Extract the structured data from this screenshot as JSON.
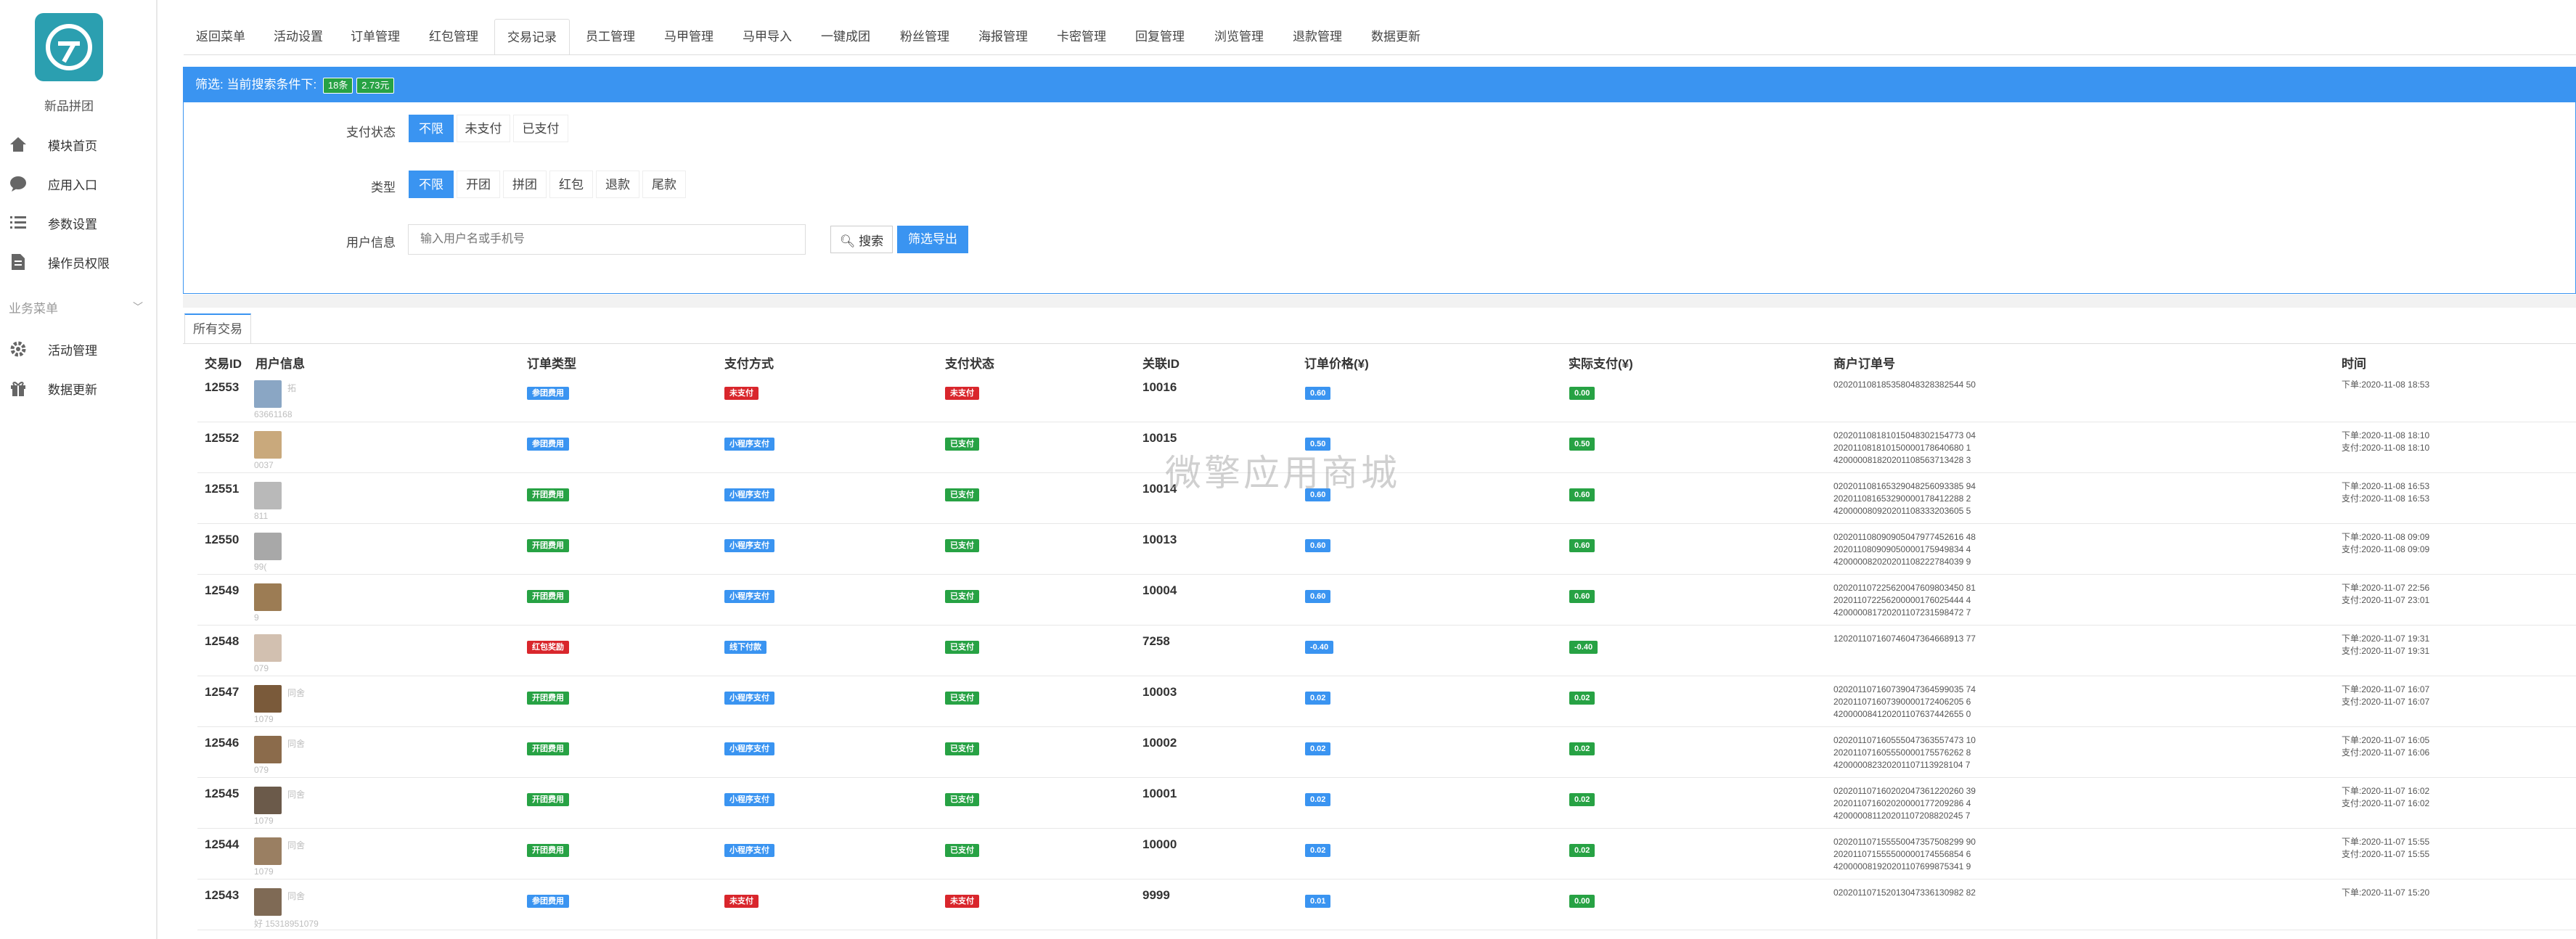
{
  "app": {
    "name": "新品拼团",
    "watermark": "微擎应用商城"
  },
  "sidebar": {
    "items": [
      {
        "label": "模块首页",
        "icon": "home-icon"
      },
      {
        "label": "应用入口",
        "icon": "chat-icon"
      },
      {
        "label": "参数设置",
        "icon": "list-icon"
      },
      {
        "label": "操作员权限",
        "icon": "document-icon"
      }
    ],
    "group": {
      "label": "业务菜单",
      "items": [
        {
          "label": "活动管理",
          "icon": "gear-icon"
        },
        {
          "label": "数据更新",
          "icon": "gift-icon"
        }
      ]
    }
  },
  "tabs": [
    {
      "label": "返回菜单"
    },
    {
      "label": "活动设置"
    },
    {
      "label": "订单管理"
    },
    {
      "label": "红包管理"
    },
    {
      "label": "交易记录",
      "active": true
    },
    {
      "label": "员工管理"
    },
    {
      "label": "马甲管理"
    },
    {
      "label": "马甲导入"
    },
    {
      "label": "一键成团"
    },
    {
      "label": "粉丝管理"
    },
    {
      "label": "海报管理"
    },
    {
      "label": "卡密管理"
    },
    {
      "label": "回复管理"
    },
    {
      "label": "浏览管理"
    },
    {
      "label": "退款管理"
    },
    {
      "label": "数据更新"
    }
  ],
  "filter": {
    "header": "筛选: 当前搜索条件下:",
    "count_badge": "18条",
    "amount_badge": "2.73元",
    "pay_status": {
      "label": "支付状态",
      "options": [
        "不限",
        "未支付",
        "已支付"
      ],
      "selected": "不限"
    },
    "type": {
      "label": "类型",
      "options": [
        "不限",
        "开团",
        "拼团",
        "红包",
        "退款",
        "尾款"
      ],
      "selected": "不限"
    },
    "user": {
      "label": "用户信息",
      "placeholder": "输入用户名或手机号"
    },
    "search_button": "搜索",
    "export_button": "筛选导出"
  },
  "table": {
    "tab_label": "所有交易",
    "headers": [
      "交易ID",
      "用户信息",
      "订单类型",
      "支付方式",
      "支付状态",
      "关联ID",
      "订单价格(¥)",
      "实际支付(¥)",
      "商户订单号",
      "时间"
    ],
    "rows": [
      {
        "id": "12553",
        "user": "拓",
        "phone": "63661168",
        "order_type": "参团费用",
        "pay_method": "未支付",
        "pay_status": "未支付",
        "ref_id": "10016",
        "price": "0.60",
        "paid": "0.00",
        "merchant": [
          "020201108185358048328382544 50"
        ],
        "time": [
          "下单:2020-11-08 18:53"
        ]
      },
      {
        "id": "12552",
        "user": "",
        "phone": "0037",
        "order_type": "参团费用",
        "pay_method": "小程序支付",
        "pay_status": "已支付",
        "ref_id": "10015",
        "price": "0.50",
        "paid": "0.50",
        "merchant": [
          "020201108181015048302154773 04",
          "202011081810150000178640680 1",
          "420000081820201108563713428 3"
        ],
        "time": [
          "下单:2020-11-08 18:10",
          "支付:2020-11-08 18:10"
        ]
      },
      {
        "id": "12551",
        "user": "",
        "phone": "811",
        "order_type": "开团费用",
        "pay_method": "小程序支付",
        "pay_status": "已支付",
        "ref_id": "10014",
        "price": "0.60",
        "paid": "0.60",
        "merchant": [
          "020201108165329048256093385 94",
          "202011081653290000178412288 2",
          "420000080920201108333203605 5"
        ],
        "time": [
          "下单:2020-11-08 16:53",
          "支付:2020-11-08 16:53"
        ]
      },
      {
        "id": "12550",
        "user": "",
        "phone": "99(",
        "order_type": "开团费用",
        "pay_method": "小程序支付",
        "pay_status": "已支付",
        "ref_id": "10013",
        "price": "0.60",
        "paid": "0.60",
        "merchant": [
          "020201108090905047977452616 48",
          "202011080909050000175949834 4",
          "420000082020201108222784039 9"
        ],
        "time": [
          "下单:2020-11-08 09:09",
          "支付:2020-11-08 09:09"
        ]
      },
      {
        "id": "12549",
        "user": "",
        "phone": "9",
        "order_type": "开团费用",
        "pay_method": "小程序支付",
        "pay_status": "已支付",
        "ref_id": "10004",
        "price": "0.60",
        "paid": "0.60",
        "merchant": [
          "020201107225620047609803450 81",
          "202011072256200000176025444 4",
          "420000081720201107231598472 7"
        ],
        "time": [
          "下单:2020-11-07 22:56",
          "支付:2020-11-07 23:01"
        ]
      },
      {
        "id": "12548",
        "user": "",
        "phone": "079",
        "order_type": "红包奖励",
        "pay_method": "线下付款",
        "pay_status": "已支付",
        "ref_id": "7258",
        "price": "-0.40",
        "paid": "-0.40",
        "merchant": [
          "120201107160746047364668913 77"
        ],
        "time": [
          "下单:2020-11-07 19:31",
          "支付:2020-11-07 19:31"
        ]
      },
      {
        "id": "12547",
        "user": "同舍",
        "phone": "1079",
        "order_type": "开团费用",
        "pay_method": "小程序支付",
        "pay_status": "已支付",
        "ref_id": "10003",
        "price": "0.02",
        "paid": "0.02",
        "merchant": [
          "020201107160739047364599035 74",
          "202011071607390000172406205 6",
          "420000084120201107637442655 0"
        ],
        "time": [
          "下单:2020-11-07 16:07",
          "支付:2020-11-07 16:07"
        ]
      },
      {
        "id": "12546",
        "user": "同舍",
        "phone": "079",
        "order_type": "开团费用",
        "pay_method": "小程序支付",
        "pay_status": "已支付",
        "ref_id": "10002",
        "price": "0.02",
        "paid": "0.02",
        "merchant": [
          "020201107160555047363557473 10",
          "202011071605550000175576262 8",
          "420000082320201107113928104 7"
        ],
        "time": [
          "下单:2020-11-07 16:05",
          "支付:2020-11-07 16:06"
        ]
      },
      {
        "id": "12545",
        "user": "同舍",
        "phone": "1079",
        "order_type": "开团费用",
        "pay_method": "小程序支付",
        "pay_status": "已支付",
        "ref_id": "10001",
        "price": "0.02",
        "paid": "0.02",
        "merchant": [
          "020201107160202047361220260 39",
          "202011071602020000177209286 4",
          "420000081120201107208820245 7"
        ],
        "time": [
          "下单:2020-11-07 16:02",
          "支付:2020-11-07 16:02"
        ]
      },
      {
        "id": "12544",
        "user": "同舍",
        "phone": "1079",
        "order_type": "开团费用",
        "pay_method": "小程序支付",
        "pay_status": "已支付",
        "ref_id": "10000",
        "price": "0.02",
        "paid": "0.02",
        "merchant": [
          "020201107155550047357508299 90",
          "202011071555500000174556854 6",
          "420000081920201107699875341 9"
        ],
        "time": [
          "下单:2020-11-07 15:55",
          "支付:2020-11-07 15:55"
        ]
      },
      {
        "id": "12543",
        "user": "同舍",
        "phone": "好 15318951079",
        "order_type": "参团费用",
        "pay_method": "未支付",
        "pay_status": "未支付",
        "ref_id": "9999",
        "price": "0.01",
        "paid": "0.00",
        "merchant": [
          "020201107152013047336130982 82"
        ],
        "time": [
          "下单:2020-11-07 15:20"
        ]
      }
    ]
  },
  "colors": {
    "primary": "#3a94f1",
    "success": "#27a244",
    "danger": "#d9262c",
    "info": "#3a94f1"
  }
}
